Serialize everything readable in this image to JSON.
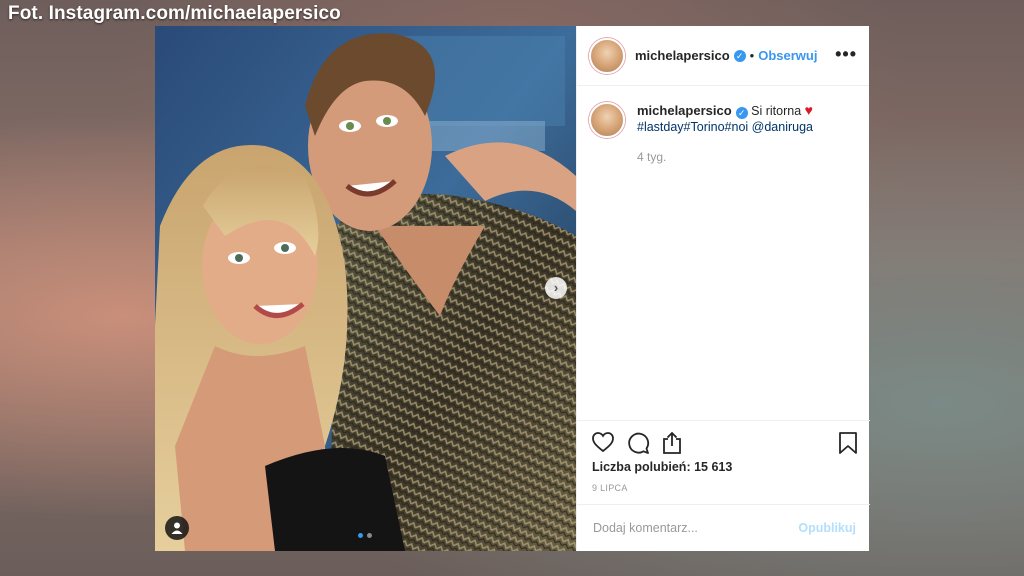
{
  "credit": "Fot. Instagram.com/michaelapersico",
  "header": {
    "username": "michelapersico",
    "separator": "•",
    "follow_label": "Obserwuj",
    "more_label": "•••"
  },
  "caption": {
    "username": "michelapersico",
    "text": "Si ritorna",
    "emoji": "♥",
    "tags": "#lastday#Torino#noi @daniruga",
    "age": "4 tyg."
  },
  "photo": {
    "next_label": "›"
  },
  "icons": {
    "like": "heart-icon",
    "comment": "comment-icon",
    "share": "share-icon",
    "save": "bookmark-icon",
    "verified": "verified-badge-icon",
    "tag": "user-tag-icon",
    "next": "chevron-right-icon"
  },
  "likes": "Liczba polubień: 15 613",
  "date": "9 LIPCA",
  "comment": {
    "placeholder": "Dodaj komentarz...",
    "post_label": "Opublikuj"
  },
  "colors": {
    "accent": "#3897f0",
    "post_disabled": "#b2dffc",
    "heart": "#d8182b"
  }
}
